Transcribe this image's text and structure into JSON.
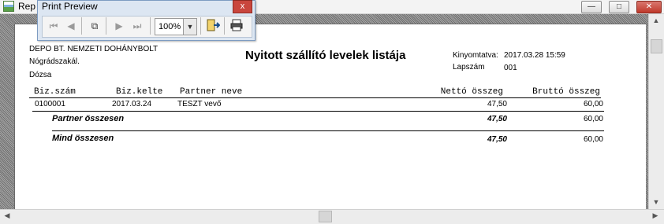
{
  "window": {
    "title": "Rep",
    "controls": {
      "minimize": "—",
      "maximize": "□",
      "close": "✕"
    }
  },
  "print_preview": {
    "title": "Print Preview",
    "close": "x",
    "zoom": "100%",
    "buttons": [
      "first-page",
      "previous-page",
      "next-page",
      "last-page",
      "copy",
      "close-preview",
      "print"
    ]
  },
  "report": {
    "company": {
      "line1": "DEPO BT. NEMZETI DOHÁNYBOLT",
      "line2": "Nógrádszakál.",
      "line3": "Dózsa"
    },
    "title": "Nyitott szállító levelek listája",
    "printed_label": "Kinyomtatva:",
    "printed_value": "2017.03.28 15:59",
    "page_label": "Lapszám",
    "page_value": "001",
    "columns": {
      "doc_no": "Biz.szám",
      "doc_date": "Biz.kelte",
      "partner": "Partner neve",
      "net": "Nettó összeg",
      "gross": "Bruttó összeg"
    },
    "rows": [
      {
        "doc_no": "0100001",
        "doc_date": "2017.03.24",
        "partner": "TESZT vevő",
        "net": "47,50",
        "gross": "60,00"
      }
    ],
    "partner_total": {
      "label": "Partner összesen",
      "net": "47,50",
      "gross": "60,00"
    },
    "grand_total": {
      "label": "Mind összesen",
      "net": "47,50",
      "gross": "60,00"
    }
  }
}
